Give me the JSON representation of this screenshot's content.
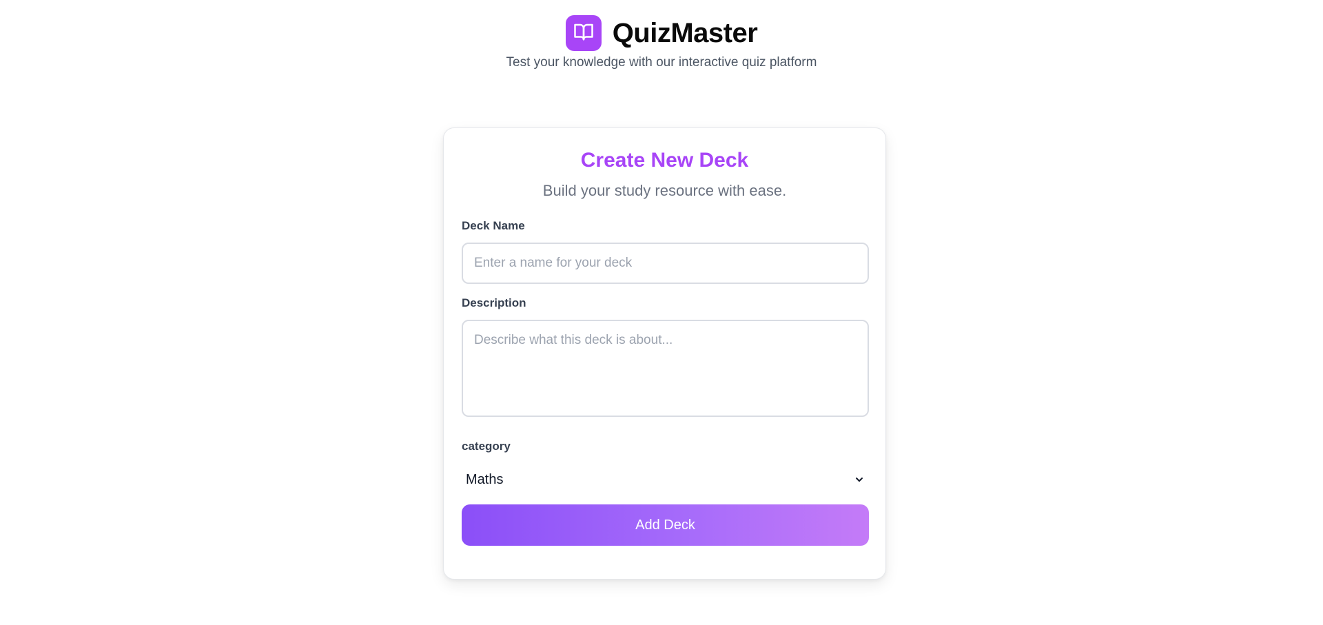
{
  "app": {
    "name": "QuizMaster",
    "tagline": "Test your knowledge with our interactive quiz platform",
    "logo_icon": "book-open-icon",
    "accent_color": "#a845f7"
  },
  "form": {
    "title": "Create New Deck",
    "subtitle": "Build your study resource with ease.",
    "deck_name": {
      "label": "Deck Name",
      "placeholder": "Enter a name for your deck",
      "value": ""
    },
    "description": {
      "label": "Description",
      "placeholder": "Describe what this deck is about...",
      "value": ""
    },
    "category": {
      "label": "category",
      "selected": "Maths",
      "icon": "chevron-down-icon"
    },
    "submit_label": "Add Deck"
  }
}
